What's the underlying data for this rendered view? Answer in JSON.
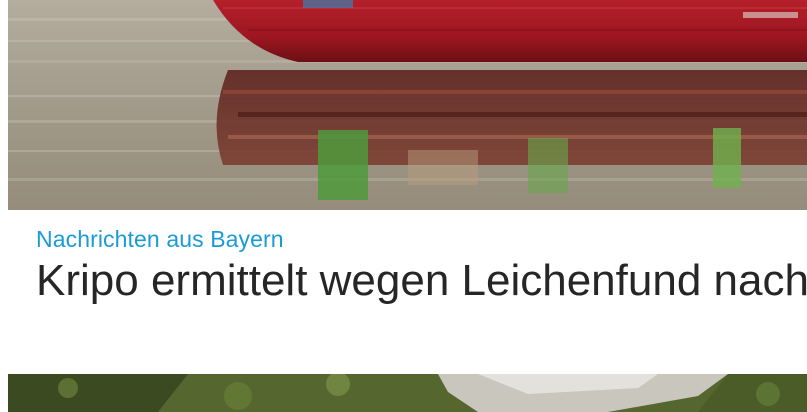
{
  "teaser": {
    "category": "Nachrichten aus Bayern",
    "headline": "Kripo ermittelt wegen Leichenfund nach Badeunfall"
  },
  "colors": {
    "category": "#1a9bd7",
    "headline": "#262626",
    "background": "#ffffff"
  }
}
